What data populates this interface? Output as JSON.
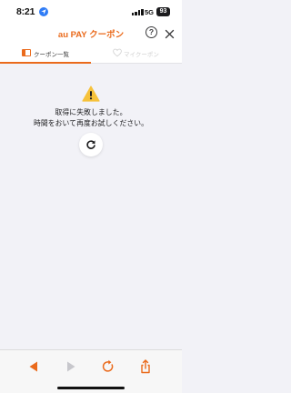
{
  "status_bar": {
    "time": "8:21",
    "network": "5G",
    "battery": "93",
    "location_icon": "location-arrow-icon",
    "signal_icon": "cellular-signal-icon"
  },
  "header": {
    "title": "au PAY クーポン",
    "help_label": "?",
    "close_icon": "close-icon"
  },
  "tabs": [
    {
      "label": "クーポン一覧",
      "icon": "coupon-list-icon",
      "active": true
    },
    {
      "label": "マイクーポン",
      "icon": "heart-icon",
      "active": false
    }
  ],
  "error": {
    "icon": "warning-icon",
    "line1": "取得に失敗しました。",
    "line2": "時間をおいて再度お試しください。",
    "retry_icon": "reload-icon"
  },
  "toolbar": {
    "back_icon": "back-arrow-icon",
    "forward_icon": "forward-arrow-icon",
    "reload_icon": "reload-icon",
    "share_icon": "share-icon"
  },
  "colors": {
    "brand": "#ea6a1b",
    "background": "#f2f2f7",
    "location": "#2f7cf6",
    "warning": "#f6c23b",
    "disabled": "#c7c7cc"
  }
}
